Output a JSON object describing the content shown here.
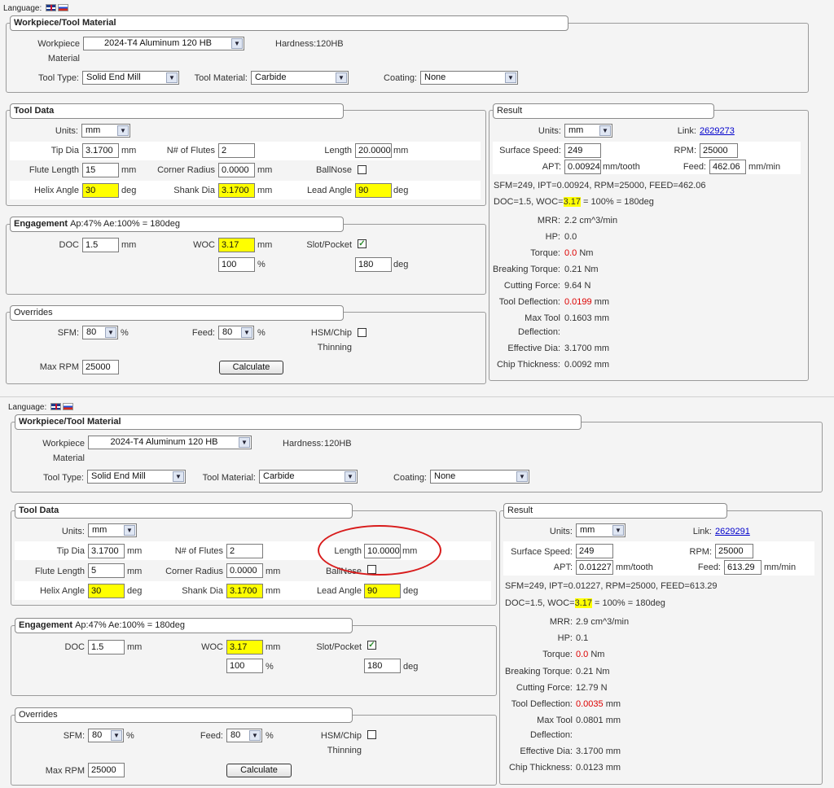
{
  "language_label": "Language:",
  "sections": {
    "workpiece": "Workpiece/Tool Material",
    "tool_data": "Tool Data",
    "engagement": "Engagement",
    "overrides": "Overrides",
    "result": "Result"
  },
  "labels": {
    "workpiece_1": "Workpiece",
    "workpiece_2": "Material",
    "hardness": "Hardness:",
    "tool_type": "Tool Type:",
    "tool_material": "Tool Material:",
    "coating": "Coating:",
    "units": "Units:",
    "tip_dia": "Tip Dia",
    "flutes": "N# of Flutes",
    "length": "Length",
    "flute_length": "Flute Length",
    "corner_radius": "Corner Radius",
    "ballnose": "BallNose",
    "helix_angle": "Helix Angle",
    "shank_dia": "Shank Dia",
    "lead_angle": "Lead Angle",
    "doc": "DOC",
    "woc": "WOC",
    "slot": "Slot/Pocket",
    "sfm": "SFM:",
    "feed": "Feed:",
    "hsm_1": "HSM/Chip",
    "hsm_2": "Thinning",
    "max_rpm": "Max RPM",
    "link": "Link:",
    "surface_speed": "Surface Speed:",
    "rpm": "RPM:",
    "apt": "APT:",
    "res_feed": "Feed:",
    "mrr": "MRR:",
    "hp": "HP:",
    "torque": "Torque:",
    "breaking_torque": "Breaking Torque:",
    "cutting_force": "Cutting Force:",
    "tool_deflection": "Tool Deflection:",
    "max_tool_1": "Max Tool",
    "max_tool_2": "Deflection:",
    "effective_dia": "Effective Dia:",
    "chip_thickness": "Chip Thickness:"
  },
  "units": {
    "mm": "mm",
    "deg": "deg",
    "pct": "%",
    "mm_tooth": "mm/tooth",
    "mm_min": "mm/min"
  },
  "calculate_label": "Calculate",
  "panels": [
    {
      "workpiece_material": "2024-T4 Aluminum 120 HB",
      "hardness": "120HB",
      "tool_type": "Solid End Mill",
      "tool_material": "Carbide",
      "coating": "None",
      "units": "mm",
      "tip_dia": "3.1700",
      "flutes": "2",
      "length": "20.0000",
      "flute_length": "15",
      "corner_radius": "0.0000",
      "helix_angle": "30",
      "shank_dia": "3.1700",
      "lead_angle": "90",
      "engagement_sub": "Ap:47% Ae:100% = 180deg",
      "doc": "1.5",
      "woc": "3.17",
      "woc_pct": "100",
      "woc_deg": "180",
      "sfm": "80",
      "feed": "80",
      "max_rpm": "25000",
      "res_units": "mm",
      "link": "2629273",
      "surface_speed": "249",
      "rpm": "25000",
      "apt": "0.00924",
      "res_feed": "462.06",
      "summary_1": "SFM=249, IPT=0.00924, RPM=25000, FEED=462.06",
      "summary_2a": "DOC=1.5, WOC=",
      "summary_2b": "3.17",
      "summary_2c": " = 100% = 180deg",
      "mrr": "2.2 cm^3/min",
      "hp": "0.0",
      "torque": "0.0",
      "torque_unit": "Nm",
      "breaking_torque": "0.21 Nm",
      "cutting_force": "9.64 N",
      "tool_deflection": "0.0199",
      "tool_deflection_unit": "mm",
      "max_tool": "0.1603 mm",
      "effective_dia": "3.1700 mm",
      "chip_thickness": "0.0092 mm"
    },
    {
      "workpiece_material": "2024-T4 Aluminum 120 HB",
      "hardness": "120HB",
      "tool_type": "Solid End Mill",
      "tool_material": "Carbide",
      "coating": "None",
      "units": "mm",
      "tip_dia": "3.1700",
      "flutes": "2",
      "length": "10.0000",
      "flute_length": "5",
      "corner_radius": "0.0000",
      "helix_angle": "30",
      "shank_dia": "3.1700",
      "lead_angle": "90",
      "engagement_sub": "Ap:47% Ae:100% = 180deg",
      "doc": "1.5",
      "woc": "3.17",
      "woc_pct": "100",
      "woc_deg": "180",
      "sfm": "80",
      "feed": "80",
      "max_rpm": "25000",
      "res_units": "mm",
      "link": "2629291",
      "surface_speed": "249",
      "rpm": "25000",
      "apt": "0.01227",
      "res_feed": "613.29",
      "summary_1": "SFM=249, IPT=0.01227, RPM=25000, FEED=613.29",
      "summary_2a": "DOC=1.5, WOC=",
      "summary_2b": "3.17",
      "summary_2c": " = 100% = 180deg",
      "mrr": "2.9 cm^3/min",
      "hp": "0.1",
      "torque": "0.0",
      "torque_unit": "Nm",
      "breaking_torque": "0.21 Nm",
      "cutting_force": "12.79 N",
      "tool_deflection": "0.0035",
      "tool_deflection_unit": "mm",
      "max_tool": "0.0801 mm",
      "effective_dia": "3.1700 mm",
      "chip_thickness": "0.0123 mm"
    }
  ],
  "colors": {
    "highlight": "#ffff00",
    "warning_value": "#dd0000",
    "annotation_circle": "#d81b1b",
    "link": "#0000cc"
  }
}
